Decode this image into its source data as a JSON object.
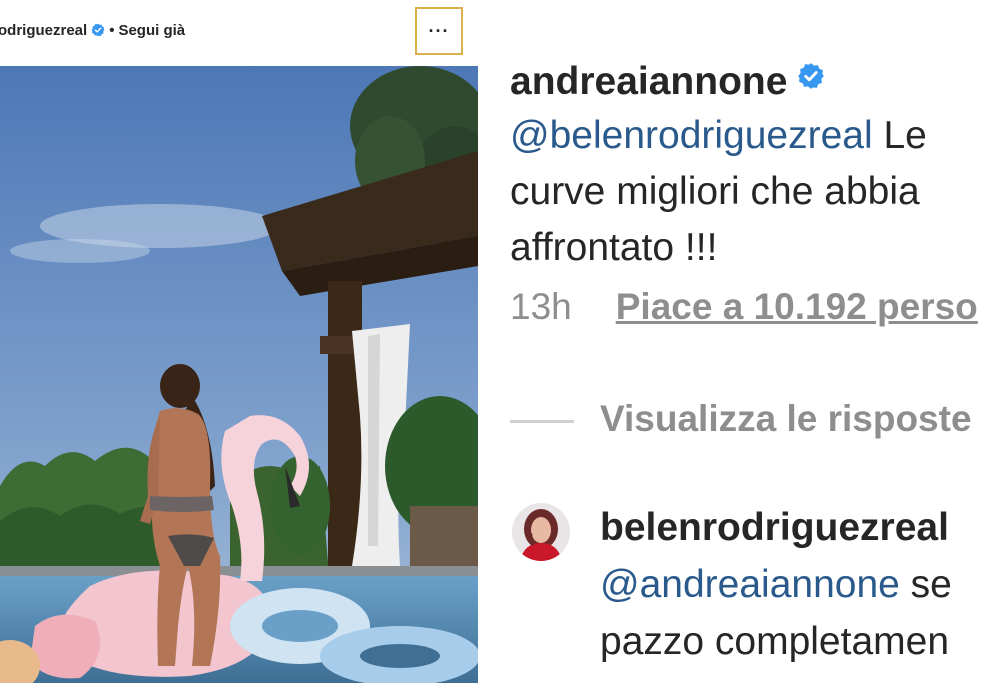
{
  "post": {
    "username": "odriguezreal",
    "separator": "•",
    "follow_status": "Segui già",
    "more_label": "···"
  },
  "comment": {
    "username": "andreaiannone",
    "mention": "@belenrodriguezreal",
    "text_line1_tail": " Le",
    "text_line2": "curve migliori che abbia",
    "text_line3": "affrontato !!!",
    "time": "13h",
    "likes": "Piace a 10.192 perso",
    "view_replies": "Visualizza le risposte"
  },
  "reply": {
    "username": "belenrodriguezreal",
    "mention": "@andreaiannone",
    "text_line1_tail": " se",
    "text_line2": "pazzo completamen"
  },
  "colors": {
    "link_blue": "#2a5a8c",
    "verified_blue": "#3897f0",
    "muted_gray": "#8e8e8e",
    "focus_outline": "#d9b24a"
  }
}
